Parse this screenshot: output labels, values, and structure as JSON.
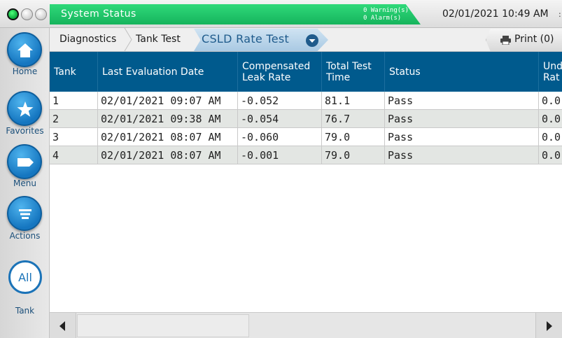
{
  "status_bar": {
    "title": "System Status",
    "warnings": "0 Warning(s)",
    "alarms": "0 Alarm(s)",
    "datetime": "02/01/2021 10:49 AM",
    "edge_char": ":",
    "colors": {
      "status_green": "#16b45c",
      "indicator": "#0aa83a"
    }
  },
  "sidebar": {
    "items": [
      {
        "label": "Home",
        "icon": "home-icon"
      },
      {
        "label": "Favorites",
        "icon": "star-icon"
      },
      {
        "label": "Menu",
        "icon": "menu-tag-icon"
      },
      {
        "label": "Actions",
        "icon": "actions-list-icon"
      }
    ],
    "filter_button": "All",
    "filter_label": "Tank"
  },
  "breadcrumb": {
    "items": [
      "Diagnostics",
      "Tank Test"
    ],
    "active": "CSLD Rate Test",
    "print_label": "Print (0)"
  },
  "table": {
    "columns": [
      "Tank",
      "Last Evaluation Date",
      "Compensated Leak Rate",
      "Total Test Time",
      "Status",
      "Und Rat"
    ],
    "rows": [
      [
        "1",
        "02/01/2021 09:07 AM",
        "-0.052",
        "81.1",
        "Pass",
        "0.0"
      ],
      [
        "2",
        "02/01/2021 09:38 AM",
        "-0.054",
        "76.7",
        "Pass",
        "0.0"
      ],
      [
        "3",
        "02/01/2021 08:07 AM",
        "-0.060",
        "79.0",
        "Pass",
        "0.0"
      ],
      [
        "4",
        "02/01/2021 08:07 AM",
        "-0.001",
        "79.0",
        "Pass",
        "0.0"
      ]
    ],
    "header_color": "#005a8d"
  }
}
